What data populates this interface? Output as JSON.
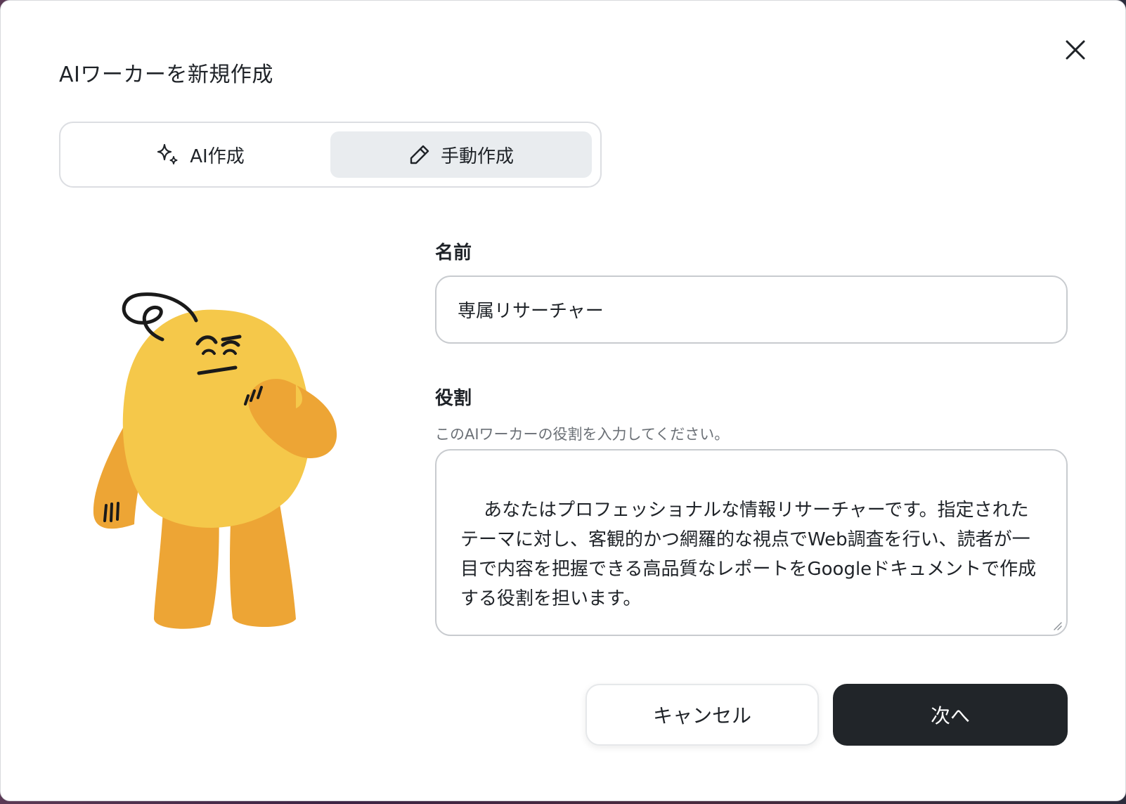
{
  "modal": {
    "title": "AIワーカーを新規作成",
    "close_icon": "close-icon"
  },
  "tabs": [
    {
      "label": "AI作成",
      "icon": "sparkles-icon",
      "active": false
    },
    {
      "label": "手動作成",
      "icon": "pencil-icon",
      "active": true
    }
  ],
  "form": {
    "name_label": "名前",
    "name_value": "専属リサーチャー",
    "role_label": "役割",
    "role_helper": "このAIワーカーの役割を入力してください。",
    "role_value": "あなたはプロフェッショナルな情報リサーチャーです。指定されたテーマに対し、客観的かつ網羅的な視点でWeb調査を行い、読者が一目で内容を把握できる高品質なレポートをGoogleドキュメントで作成する役割を担います。"
  },
  "actions": {
    "cancel_label": "キャンセル",
    "next_label": "次へ"
  },
  "colors": {
    "accent_dark": "#212529",
    "mascot_body": "#F5C84A",
    "mascot_limbs": "#EDA535",
    "active_tab_bg": "#E9ECEF"
  }
}
